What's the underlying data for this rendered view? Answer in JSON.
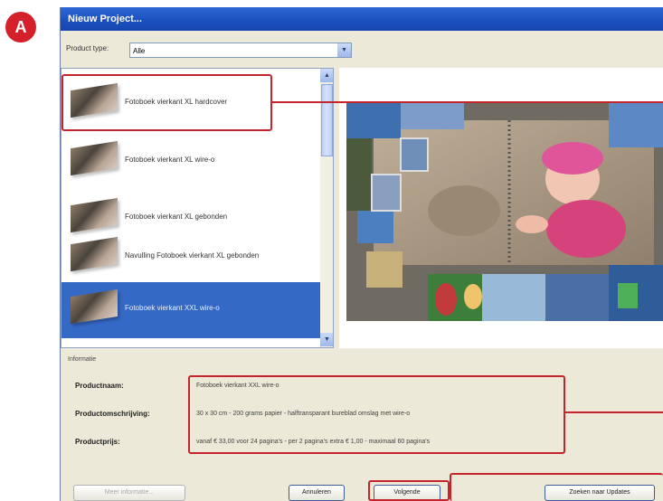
{
  "badge": "A",
  "window": {
    "title": "Nieuw Project..."
  },
  "product_type": {
    "label": "Product type:",
    "value": "Alle"
  },
  "products": [
    {
      "label": "Fotoboek vierkant XL hardcover",
      "selected": false
    },
    {
      "label": "Fotoboek vierkant XL wire-o",
      "selected": false
    },
    {
      "label": "Fotoboek vierkant XL gebonden",
      "selected": false
    },
    {
      "label": "Navulling Fotoboek vierkant XL gebonden",
      "selected": false
    },
    {
      "label": "Fotoboek vierkant XXL wire-o",
      "selected": true
    }
  ],
  "info": {
    "section_title": "Informatie",
    "name_label": "Productnaam:",
    "name_value": "Fotoboek vierkant XXL wire-o",
    "desc_label": "Productomschrijving:",
    "desc_value": "30 x 30 cm - 200 grams papier - halftransparant bureblad omslag met wire-o",
    "price_label": "Productprijs:",
    "price_value": "vanaf € 33,00 voor 24 pagina's - per 2 pagina's extra € 1,00 - maximaal 60 pagina's"
  },
  "buttons": {
    "more_info": "Meer informatie...",
    "cancel": "Annuleren",
    "next": "Volgende",
    "updates": "Zoeken naar Updates"
  },
  "accent_color": "#c4242c",
  "selection_color": "#3569c6"
}
